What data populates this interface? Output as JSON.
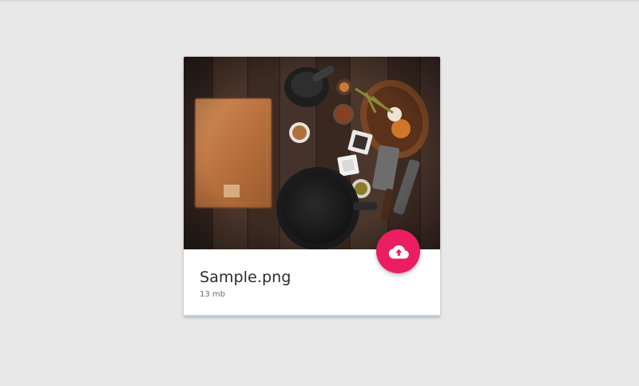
{
  "file": {
    "name": "Sample.png",
    "size": "13 mb"
  },
  "preview": {
    "image_subject": "kitchen-tools-on-wooden-table"
  },
  "upload_button": {
    "icon": "cloud-upload-icon",
    "color": "#e91e63"
  },
  "colors": {
    "page_background": "#e8e8e8",
    "card_background": "#ffffff",
    "accent": "#e91e63"
  }
}
